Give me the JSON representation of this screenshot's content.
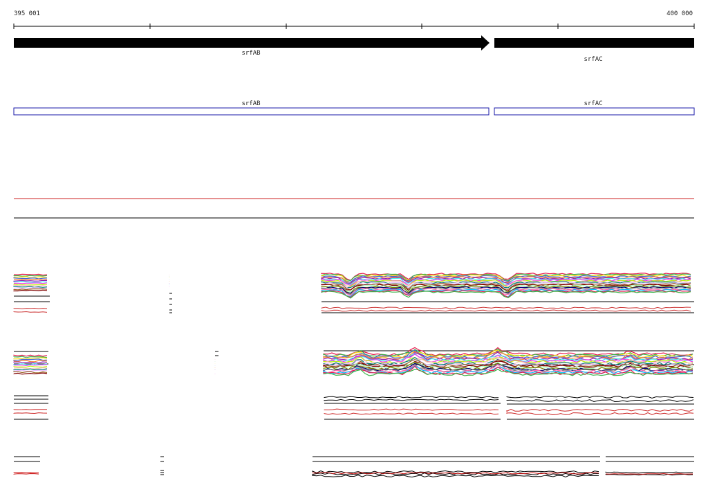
{
  "ruler": {
    "start_label": "395 001",
    "end_label": "400 000"
  },
  "genes": [
    {
      "name": "srfAB",
      "strand": "+"
    },
    {
      "name": "srfAC",
      "strand": "+"
    }
  ],
  "gene_boxes": [
    {
      "name": "srfAB"
    },
    {
      "name": "srfAC"
    }
  ],
  "colors": {
    "gene_arrow": "#000000",
    "gene_box": "#1a1aa8",
    "red_line": "#cc2222",
    "track_line": "#000000",
    "profile_palette": [
      "#e6194b",
      "#3cb44b",
      "#ffe119",
      "#4363d8",
      "#f58231",
      "#911eb4",
      "#46f0f0",
      "#f032e6",
      "#bcf60c",
      "#fabebe",
      "#008080",
      "#e6beff",
      "#9a6324",
      "#800000",
      "#aaffc3",
      "#808000",
      "#000075",
      "#808080",
      "#ff69b4",
      "#00bfff"
    ]
  }
}
